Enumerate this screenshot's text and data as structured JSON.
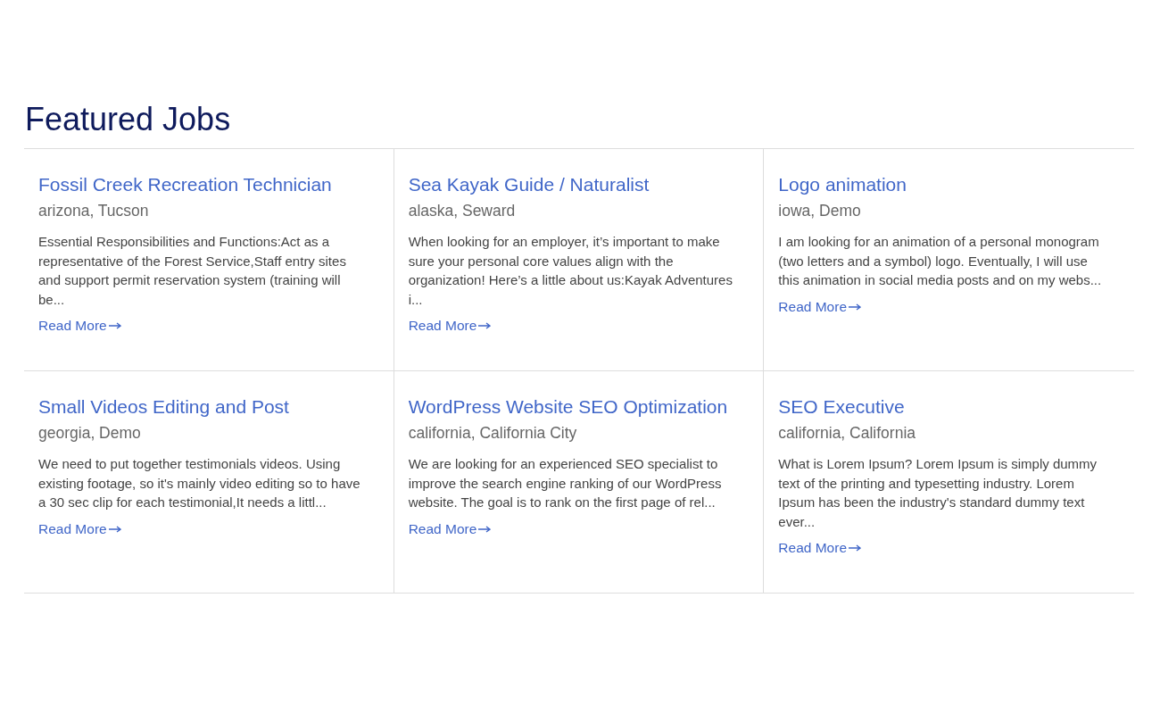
{
  "heading": "Featured Jobs",
  "jobs": [
    {
      "title": "Fossil Creek Recreation Technician",
      "location": "arizona, Tucson",
      "description": "Essential Responsibilities and Functions:Act as a representative of the Forest Service,Staff entry sites and support permit reservation system (training will be...",
      "link": "Read More"
    },
    {
      "title": "Sea Kayak Guide / Naturalist",
      "location": "alaska, Seward",
      "description": "When looking for an employer, it’s important to make sure your personal core values align with the organization! Here’s a little about us:Kayak Adventures i...",
      "link": "Read More"
    },
    {
      "title": "Logo animation",
      "location": "iowa, Demo",
      "description": "I am looking for an animation of a personal monogram (two letters and a symbol) logo. Eventually, I will use this animation in social media posts and on my webs...",
      "link": "Read More"
    },
    {
      "title": "Small Videos Editing and Post",
      "location": "georgia, Demo",
      "description": "We need to put together testimonials videos. Using existing footage, so it's mainly video editing so to have a 30 sec clip for each testimonial,It needs a littl...",
      "link": "Read More"
    },
    {
      "title": "WordPress Website SEO Optimization",
      "location": "california, California City",
      "description": "We are looking for an experienced SEO specialist to improve the search engine ranking of our WordPress website. The goal is to rank on the first page of rel...",
      "link": "Read More"
    },
    {
      "title": "SEO Executive",
      "location": "california, California",
      "description": "What is Lorem Ipsum? Lorem Ipsum is simply dummy text of the printing and typesetting industry. Lorem Ipsum has been the industry's standard dummy text ever...",
      "link": "Read More"
    }
  ]
}
